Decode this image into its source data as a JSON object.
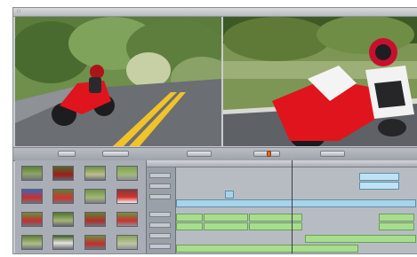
{
  "app": {
    "menu_items": [
      "",
      "",
      "",
      "",
      "",
      "",
      "",
      "",
      "",
      ""
    ]
  },
  "viewers": [
    {
      "name": "source-viewer",
      "content": "motorcycle-rider-on-road"
    },
    {
      "name": "canvas-viewer",
      "content": "motorcycle-rider-closeup"
    }
  ],
  "toolbar": {
    "buttons": [
      "",
      "",
      "",
      "",
      ""
    ]
  },
  "colors": {
    "clip_blue": "#a9d3ea",
    "clip_green": "#a8dd8f",
    "motorcycle_red": "#e0141c"
  }
}
